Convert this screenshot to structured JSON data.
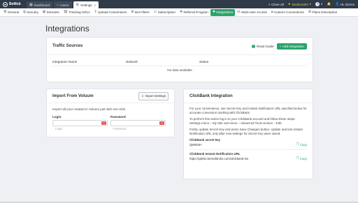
{
  "topbar": {
    "logo_text": "BeMob",
    "tabs": [
      {
        "label": "Dashboard",
        "icon": "dashboard-icon"
      },
      {
        "label": "Home",
        "icon": "home-icon"
      },
      {
        "label": "Settings",
        "icon": "gear-icon",
        "close": "×"
      }
    ],
    "close_all": "Close all",
    "bookmarks": "Bookmarks",
    "user_name": "HL Donns"
  },
  "nav": {
    "items": [
      {
        "label": "General",
        "icon": "gear-icon"
      },
      {
        "label": "Security",
        "icon": "shield-icon"
      },
      {
        "label": "Domains",
        "icon": "globe-icon"
      },
      {
        "label": "Tracking URLs",
        "icon": "link-icon"
      },
      {
        "label": "Upload Conversions",
        "icon": "upload-icon"
      },
      {
        "label": "Bot Filters",
        "icon": "filter-icon"
      },
      {
        "label": "Subscription",
        "icon": "card-icon"
      },
      {
        "label": "Referral Program",
        "icon": "gift-icon"
      },
      {
        "label": "Integrations",
        "icon": "puzzle-icon"
      },
      {
        "label": "Multi-User Access",
        "icon": "users-icon"
      },
      {
        "label": "Custom Conversions",
        "icon": "tag-icon"
      },
      {
        "label": "Plans Description",
        "icon": "doc-icon"
      }
    ]
  },
  "page": {
    "title": "Integrations"
  },
  "traffic": {
    "title": "Traffic Sources",
    "read_guide": "Read Guide",
    "add_button": "Add Integration",
    "columns": [
      "Integration Name",
      "Network",
      "Status"
    ],
    "empty": "No data available"
  },
  "volum": {
    "title": "Import From Voluum",
    "import_button": "Import Settings",
    "description": "Import all your created in Voluum just with one click",
    "login_label": "Login",
    "login_placeholder": "Login",
    "password_label": "Password",
    "password_placeholder": "Password"
  },
  "clickbank": {
    "title": "ClickBank Integration",
    "p1": "For your convenience, use Secret Key and Instant Notification URL specified below for accurate conversion tracking with ClickBank.",
    "p2": "To perform this action log in to your ClickBank account and follow these steps: Settings menu – My Site sub-menu – Advanced Tools section – Edit.",
    "p3": "Firstly, update Secret Key and press Save Changes button. Update and test Instant Notification URL only after new settings for Secret Key were saved.",
    "secret_key_label": "ClickBank secret key",
    "secret_key_value": "Q6R53H",
    "ipn_label": "ClickBank Instant Notification URL",
    "ipn_value": "https://q6r5n.bemobtrcks.com/clickbank-ins",
    "copy_label": "Copy"
  },
  "colors": {
    "topbar": "#2f3b49",
    "accent": "#2aa36b",
    "bookmarks": "#f4c542"
  }
}
